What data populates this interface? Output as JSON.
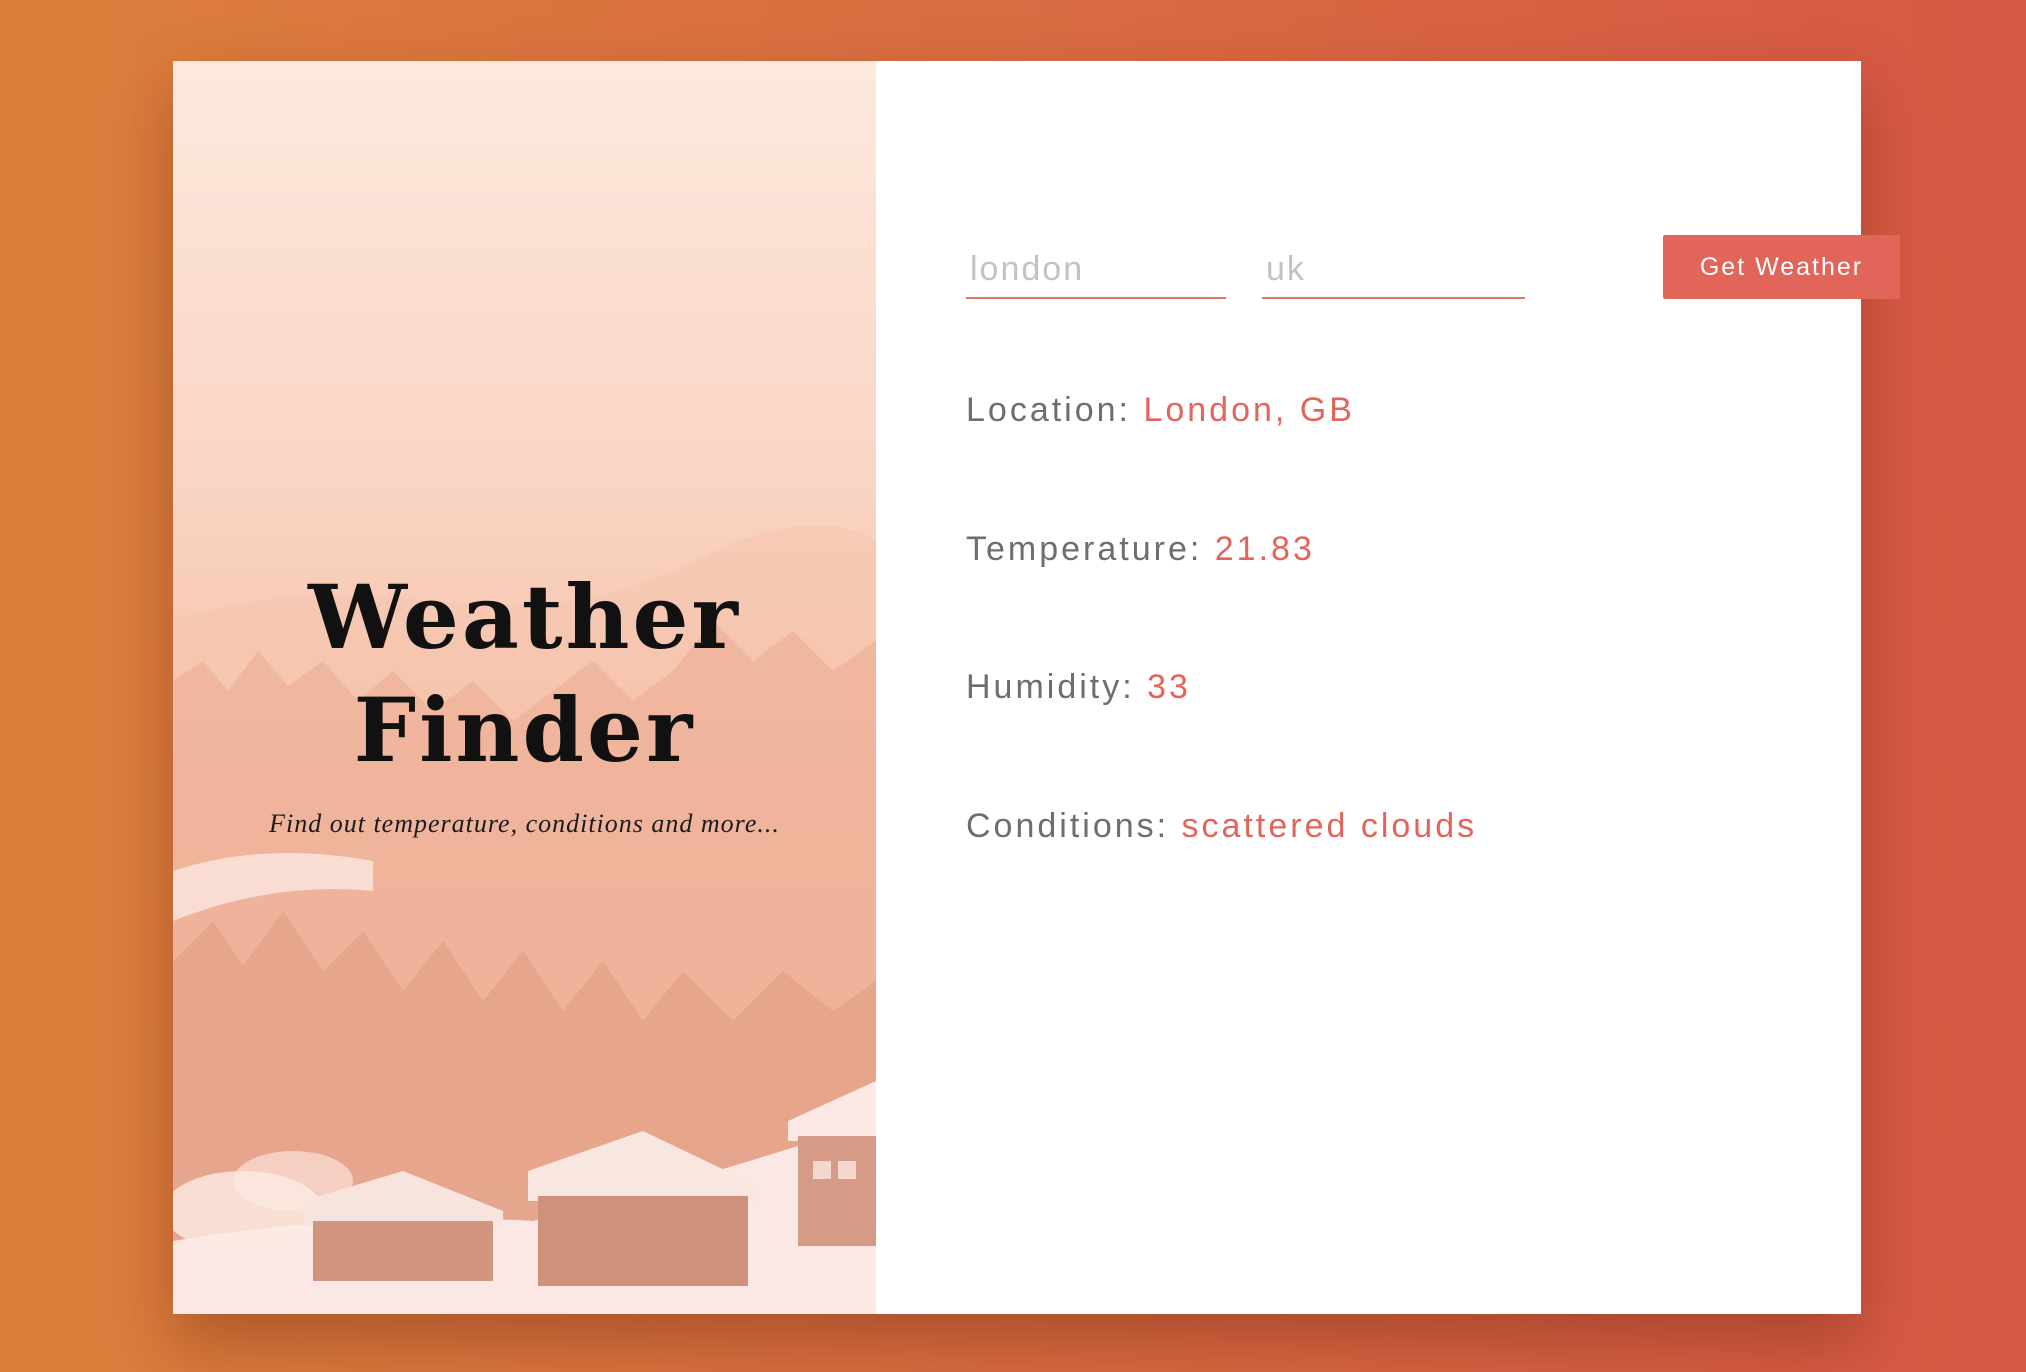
{
  "hero": {
    "title_line1": "Weather",
    "title_line2": "Finder",
    "subtitle": "Find out temperature, conditions and more..."
  },
  "form": {
    "city_value": "london",
    "country_value": "uk",
    "submit_label": "Get Weather"
  },
  "results": {
    "location_label": "Location:",
    "location_value": "London, GB",
    "temperature_label": "Temperature:",
    "temperature_value": "21.83",
    "humidity_label": "Humidity:",
    "humidity_value": "33",
    "conditions_label": "Conditions:",
    "conditions_value": "scattered clouds"
  },
  "colors": {
    "accent": "#e2655a",
    "label": "#6e6e6e",
    "background_start": "#dc7f3c",
    "background_end": "#d65744"
  }
}
